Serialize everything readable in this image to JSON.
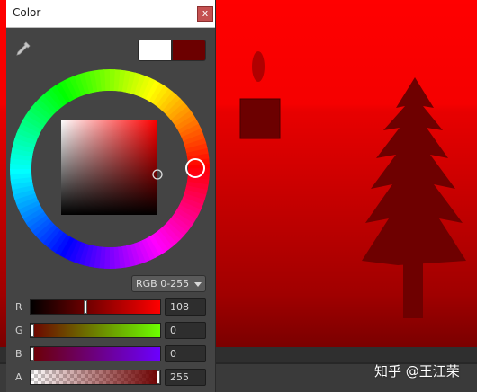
{
  "window": {
    "title": "Color",
    "close_label": "x"
  },
  "picker": {
    "mode_label": "RGB 0-255"
  },
  "channels": [
    {
      "label": "R",
      "value": "108",
      "level": 0.42
    },
    {
      "label": "G",
      "value": "0",
      "level": 0
    },
    {
      "label": "B",
      "value": "0",
      "level": 0
    },
    {
      "label": "A",
      "value": "255",
      "level": 1
    }
  ],
  "colors": {
    "current": "#ffffff",
    "previous": "#6c0000",
    "scene_red": "#ff0000",
    "tree": "#6e0000"
  },
  "watermark": "知乎 @王江荣",
  "icons": {
    "eyedropper": "eyedropper-icon",
    "close": "close-icon",
    "dropdown": "chevron-down-icon"
  }
}
